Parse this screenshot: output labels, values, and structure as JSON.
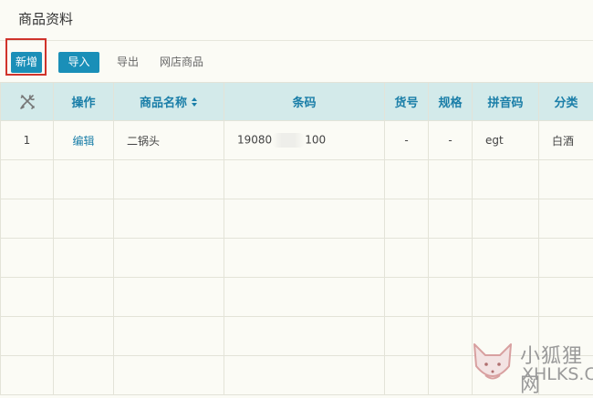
{
  "page": {
    "title": "商品资料"
  },
  "toolbar": {
    "new_label": "新增",
    "import_label": "导入",
    "export_label": "导出",
    "shop_goods_label": "网店商品"
  },
  "table": {
    "settings_icon": "tools-icon",
    "headers": [
      "操作",
      "商品名称",
      "条码",
      "货号",
      "规格",
      "拼音码",
      "分类"
    ],
    "rows": [
      {
        "index": "1",
        "action": "编辑",
        "name": "二锅头",
        "barcode_prefix": "19080",
        "barcode_suffix": "100",
        "item_no": "-",
        "spec": "-",
        "pinyin": "egt",
        "category": "白酒"
      }
    ]
  },
  "watermark": {
    "cn": "小狐狸网",
    "en": "XHLKS.CN"
  },
  "colors": {
    "primary": "#1a8fb8",
    "header_bg": "#d3eaea",
    "header_text": "#1a7ea8",
    "highlight": "#d0332b"
  }
}
